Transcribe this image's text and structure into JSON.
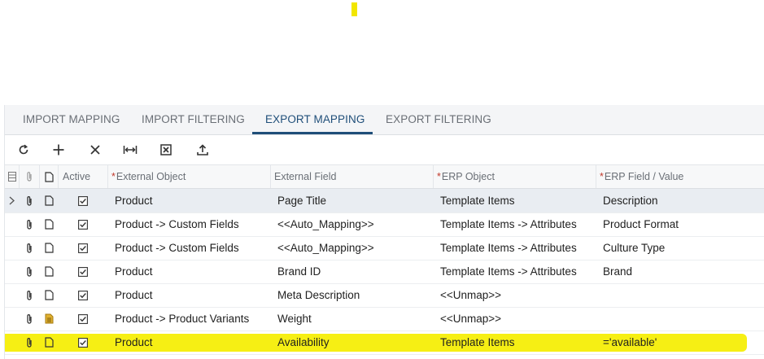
{
  "tabs": [
    {
      "label": "IMPORT MAPPING",
      "active": false
    },
    {
      "label": "IMPORT FILTERING",
      "active": false
    },
    {
      "label": "EXPORT MAPPING",
      "active": true
    },
    {
      "label": "EXPORT FILTERING",
      "active": false
    }
  ],
  "toolbar": {
    "buttons": [
      "refresh-icon",
      "add-icon",
      "delete-icon",
      "fit-columns-icon",
      "excel-export-icon",
      "upload-icon"
    ]
  },
  "grid": {
    "columns": {
      "active": "Active",
      "external_object": "External Object",
      "external_field": "External Field",
      "erp_object": "ERP Object",
      "erp_field": "ERP Field / Value"
    },
    "required_marker": "*",
    "rows": [
      {
        "external_object": "Product",
        "external_field": "Page Title",
        "erp_object": "Template Items",
        "erp_field": "Description",
        "has_note": false
      },
      {
        "external_object": "Product -> Custom Fields",
        "external_field": "<<Auto_Mapping>>",
        "erp_object": "Template Items -> Attributes",
        "erp_field": "Product Format",
        "has_note": false
      },
      {
        "external_object": "Product -> Custom Fields",
        "external_field": "<<Auto_Mapping>>",
        "erp_object": "Template Items -> Attributes",
        "erp_field": "Culture Type",
        "has_note": false
      },
      {
        "external_object": "Product",
        "external_field": "Brand ID",
        "erp_object": "Template Items -> Attributes",
        "erp_field": "Brand",
        "has_note": false
      },
      {
        "external_object": "Product",
        "external_field": "Meta Description",
        "erp_object": "<<Unmap>>",
        "erp_field": "",
        "has_note": false
      },
      {
        "external_object": "Product -> Product Variants",
        "external_field": "Weight",
        "erp_object": "<<Unmap>>",
        "erp_field": "",
        "has_note": true
      },
      {
        "external_object": "Product",
        "external_field": "Availability",
        "erp_object": "Template Items",
        "erp_field": "='available'",
        "has_note": false
      }
    ]
  },
  "colors": {
    "accent": "#1f4e79",
    "highlight": "#f5ee00",
    "required": "#c0392b"
  }
}
